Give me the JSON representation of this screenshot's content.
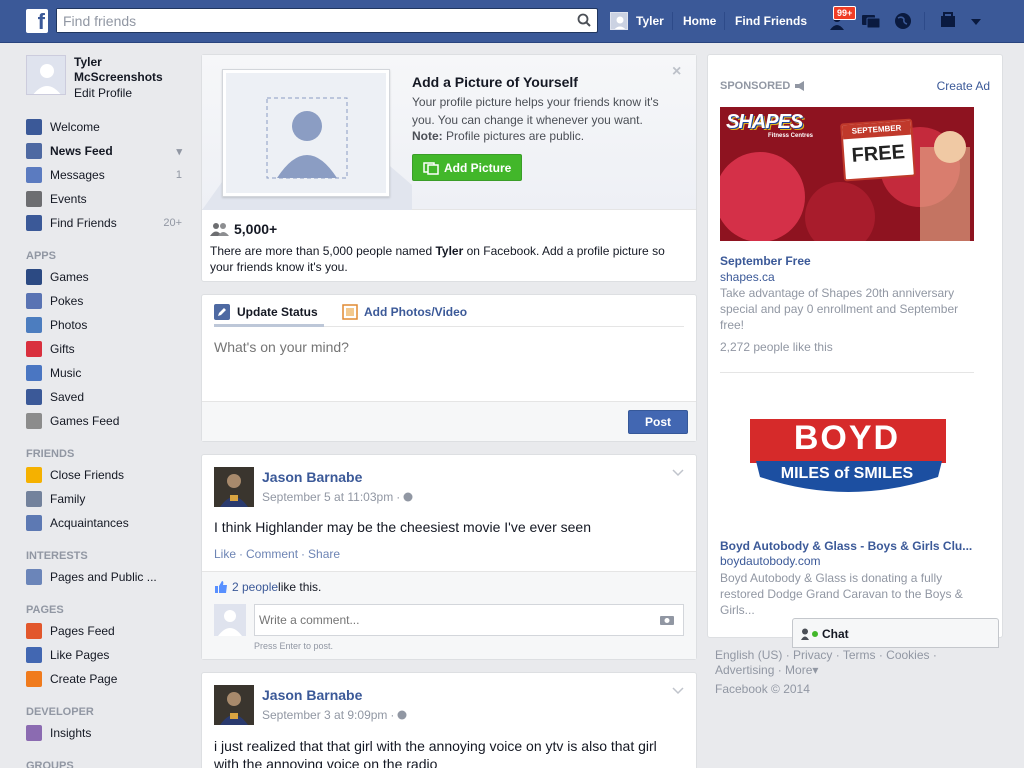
{
  "topbar": {
    "logo": "f",
    "search_placeholder": "Find friends",
    "user_name": "Tyler",
    "home": "Home",
    "find_friends": "Find Friends",
    "friend_requests_badge": "99+"
  },
  "leftnav": {
    "name_line1": "Tyler",
    "name_line2": "McScreenshots",
    "edit_profile": "Edit Profile",
    "main_items": [
      {
        "label": "Welcome",
        "count": "",
        "icon": "welcome-icon",
        "color": "#3b5998"
      },
      {
        "label": "News Feed",
        "count": "",
        "icon": "news-feed-icon",
        "color": "#4e69a2"
      },
      {
        "label": "Messages",
        "count": "1",
        "icon": "messages-icon",
        "color": "#5b7bc0"
      },
      {
        "label": "Events",
        "count": "",
        "icon": "events-icon",
        "color": "#6d6e71"
      },
      {
        "label": "Find Friends",
        "count": "20+",
        "icon": "find-friends-icon",
        "color": "#3b5998"
      }
    ],
    "apps_heading": "APPS",
    "apps": [
      {
        "label": "Games",
        "icon": "games-icon",
        "color": "#2c4a83"
      },
      {
        "label": "Pokes",
        "icon": "pokes-icon",
        "color": "#5973b3"
      },
      {
        "label": "Photos",
        "icon": "photos-icon",
        "color": "#4c7dbf"
      },
      {
        "label": "Gifts",
        "icon": "gifts-icon",
        "color": "#d9303e"
      },
      {
        "label": "Music",
        "icon": "music-icon",
        "color": "#4a76c2"
      },
      {
        "label": "Saved",
        "icon": "saved-icon",
        "color": "#3b5998"
      },
      {
        "label": "Games Feed",
        "icon": "games-feed-icon",
        "color": "#8c8c8c"
      }
    ],
    "friends_heading": "FRIENDS",
    "friends": [
      {
        "label": "Close Friends",
        "icon": "star-icon",
        "color": "#f5b100"
      },
      {
        "label": "Family",
        "icon": "family-icon",
        "color": "#73829c"
      },
      {
        "label": "Acquaintances",
        "icon": "acquaintances-icon",
        "color": "#5d79b3"
      }
    ],
    "interests_heading": "INTERESTS",
    "interests": [
      {
        "label": "Pages and Public ...",
        "icon": "pages-public-icon",
        "color": "#6b85b9"
      }
    ],
    "pages_heading": "PAGES",
    "pages": [
      {
        "label": "Pages Feed",
        "icon": "pages-feed-icon",
        "color": "#e2572c"
      },
      {
        "label": "Like Pages",
        "icon": "like-pages-icon",
        "color": "#4267b2"
      },
      {
        "label": "Create Page",
        "icon": "create-page-icon",
        "color": "#f07b1d"
      }
    ],
    "developer_heading": "DEVELOPER",
    "developer": [
      {
        "label": "Insights",
        "icon": "insights-icon",
        "color": "#8b6bb1"
      }
    ],
    "groups_heading": "GROUPS"
  },
  "photo_prompt": {
    "title": "Add a Picture of Yourself",
    "desc": "Your profile picture helps your friends know it's you. You can change it whenever you want.",
    "note_label": "Note:",
    "note_text": "Profile pictures are public.",
    "button": "Add Picture",
    "count": "5,000+",
    "info_pre": "There are more than 5,000 people named ",
    "info_name": "Tyler",
    "info_post": " on Facebook. Add a profile picture so your friends know it's you."
  },
  "composer": {
    "tab_status": "Update Status",
    "tab_photos": "Add Photos/Video",
    "placeholder": "What's on your mind?",
    "post_button": "Post"
  },
  "posts": [
    {
      "author": "Jason Barnabe",
      "time": "September 5 at 11:03pm",
      "text": "I think Highlander may be the cheesiest movie I've ever seen",
      "like": "Like",
      "comment": "Comment",
      "share": "Share",
      "likes_link": "2 people",
      "likes_rest": " like this.",
      "comment_placeholder": "Write a comment...",
      "press_enter": "Press Enter to post."
    },
    {
      "author": "Jason Barnabe",
      "time": "September 3 at 9:09pm",
      "text": "i just realized that that girl with the annoying voice on ytv is also that girl with the annoying voice on the radio"
    }
  ],
  "sponsored": {
    "heading": "SPONSORED",
    "create_ad": "Create Ad",
    "ads": [
      {
        "image_brand": "SHAPES",
        "image_sub": "Fitness Centres",
        "image_badge_top": "SEPTEMBER",
        "image_badge_main": "FREE",
        "title": "September Free",
        "domain": "shapes.ca",
        "desc": "Take advantage of Shapes 20th anniversary special and pay 0 enrollment and September free!",
        "likes": "2,272 people like this"
      },
      {
        "image_brand": "BOYD",
        "image_sub": "MILES of SMILES",
        "title": "Boyd Autobody & Glass - Boys & Girls Clu...",
        "domain": "boydautobody.com",
        "desc": "Boyd Autobody & Glass is donating a fully restored Dodge Grand Caravan to the Boys & Girls..."
      }
    ]
  },
  "footer": {
    "links": [
      "English (US)",
      "Privacy",
      "Terms",
      "Cookies",
      "Advertising",
      "More"
    ],
    "copyright": "Facebook © 2014"
  },
  "chat": {
    "label": "Chat"
  }
}
